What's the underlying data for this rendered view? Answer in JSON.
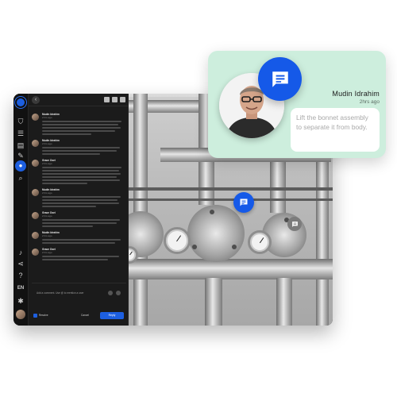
{
  "rail": {
    "items": [
      {
        "name": "shield-icon",
        "glyph": "⛉"
      },
      {
        "name": "chat-list-icon",
        "glyph": "☰"
      },
      {
        "name": "clipboard-icon",
        "glyph": "▤"
      },
      {
        "name": "pencil-icon",
        "glyph": "✎"
      },
      {
        "name": "comments-icon",
        "glyph": "●"
      },
      {
        "name": "search-icon",
        "glyph": "⌕"
      }
    ],
    "bottom_items": [
      {
        "name": "bell-icon",
        "glyph": "♪"
      },
      {
        "name": "share-icon",
        "glyph": "⋖"
      },
      {
        "name": "help-icon",
        "glyph": "?"
      },
      {
        "name": "language-label",
        "glyph": "EN"
      },
      {
        "name": "settings-icon",
        "glyph": "✱"
      }
    ]
  },
  "thread": {
    "messages": [
      {
        "name": "Mudin Idrahim",
        "time": "2 hrs ago"
      },
      {
        "name": "Mudin Idrahim",
        "time": "2 hrs ago"
      },
      {
        "name": "Grace Osei",
        "time": "2 hrs ago"
      },
      {
        "name": "Mudin Idrahim",
        "time": "2 hrs ago"
      },
      {
        "name": "Grace Osei",
        "time": "2 hrs ago"
      },
      {
        "name": "Mudin Idrahim",
        "time": "2 hrs ago"
      },
      {
        "name": "Grace Osei",
        "time": "2 hrs ago"
      }
    ],
    "composer_placeholder": "Add a comment. Use @ to mention a user",
    "resolve_label": "Resolve",
    "cancel_label": "Cancel",
    "reply_label": "Reply"
  },
  "card": {
    "author": "Mudin Idrahim",
    "time": "2hrs ago",
    "text": "Lift the bonnet assembly to separate it from body."
  },
  "colors": {
    "accent": "#1559e8",
    "card_bg": "#cdeedd",
    "sidebar_bg": "#1b1b1b"
  }
}
